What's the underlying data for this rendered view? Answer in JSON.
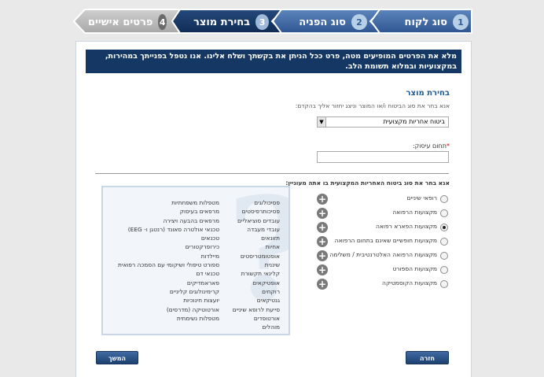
{
  "steps": [
    {
      "num": "1",
      "label": "סוג לקוח",
      "state": "done"
    },
    {
      "num": "2",
      "label": "סוג הפניה",
      "state": "done"
    },
    {
      "num": "3",
      "label": "בחירת מוצר",
      "state": "active"
    },
    {
      "num": "4",
      "label": "פרטים אישיים",
      "state": "todo"
    }
  ],
  "notice": "מלא את הפרטים המופיעים מטה, פרט ככל הניתן את בקשתך ושלח אלינו. אנו נטפל בפנייתך במהירות, במקצועיות ובמלוא תשומת הלב.",
  "product_section": {
    "title": "בחירת מוצר",
    "hint": "אנא בחר את סוג הביטוח ו/או המוצר וניצג יחזור אליך בהקדם:",
    "select_value": "ביטוח אחריות מקצועית",
    "field_label": "תחום עיסוק:",
    "field_required": "*"
  },
  "question": "אנא בחר את סוג ביטוח האחריות המקצועית בו אתה מעוניין:",
  "options": [
    {
      "label": "רופאי שיניים",
      "selected": false
    },
    {
      "label": "מקצועות הרפואה",
      "selected": false
    },
    {
      "label": "מקצועות הפארא רפואה",
      "selected": true
    },
    {
      "label": "מקצועות חופשיים שאינם בתחום הרפואה",
      "selected": false
    },
    {
      "label": "מקצועות הרפואה האלטרנטיבית / משלימה",
      "selected": false
    },
    {
      "label": "מקצועות הספורט",
      "selected": false
    },
    {
      "label": "מקצועות הקוסמטיקה",
      "selected": false
    }
  ],
  "professions_right": [
    "פסיכולוגים",
    "פסיכותרפיסטים",
    "עובדים סוציאליים",
    "עובדי מעבדה",
    "תזונאים",
    "אחיות",
    "אופטומטריסטים",
    "שיננית",
    "קלינאי תקשורת",
    "אופטיקאים",
    "רוקחים",
    "גנטיקאים",
    "סייעת לרופא שיניים",
    "אורטופדים",
    "מוהלים"
  ],
  "professions_left": [
    "מטפלות משפחתיות",
    "מרפאים בעיסוק",
    "מרפאים בהבעה ויצירה",
    "טכנאי אולטרה סאונד (רנטגן ו- EEG)",
    "טכנאים",
    "כירופרקטורים",
    "מיילדות",
    "ספורט טיפולי ושיקומי עם הסמכה רפואית",
    "טכנאי דם",
    "פאראמדיקים",
    "קרימינולוגים קליניים",
    "יועצות חינוכיות",
    "אורטוטיקה (מדרסים)",
    "מטפלות נשימתית"
  ],
  "buttons": {
    "back": "חזרה",
    "next": "המשך"
  }
}
